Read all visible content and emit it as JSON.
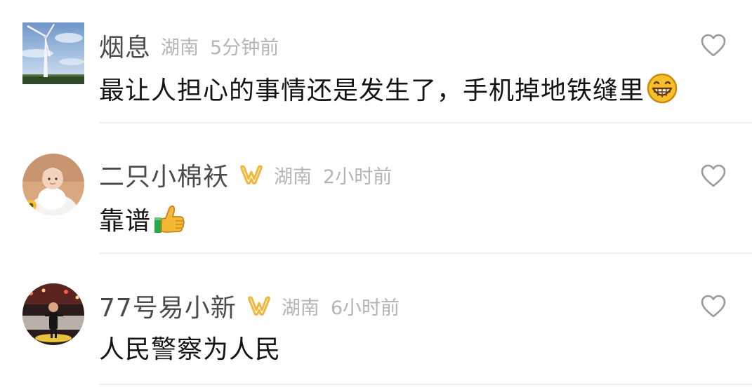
{
  "comments": [
    {
      "username": "烟息",
      "location": "湖南",
      "time": "5分钟前",
      "text": "最让人担心的事情还是发生了，手机掉地铁缝里",
      "emoji": "grinning-face-emoji",
      "vip": false
    },
    {
      "username": "二只小棉袄",
      "location": "湖南",
      "time": "2小时前",
      "text": "靠谱",
      "emoji": "thumbs-up-emoji",
      "vip": true
    },
    {
      "username": "77号易小新",
      "location": "湖南",
      "time": "6小时前",
      "text": "人民警察为人民",
      "vip": true
    }
  ],
  "colors": {
    "username": "#4b4b4b",
    "meta": "#b4b4b4",
    "text": "#141414",
    "vip_badge": "#f2b63a",
    "like_icon": "#9a9a9a",
    "divider": "#eeeeee"
  },
  "icons": {
    "like": "heart-outline-icon",
    "vip": "vip-badge-icon"
  }
}
